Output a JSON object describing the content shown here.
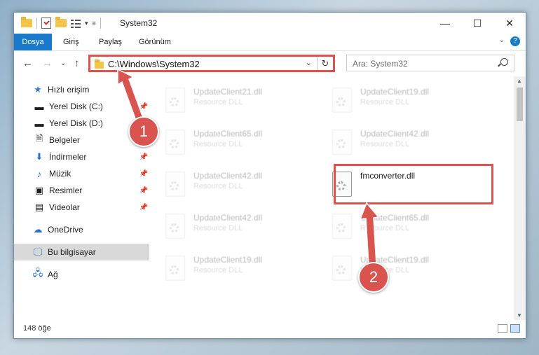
{
  "window": {
    "title": "System32",
    "controls": {
      "minimize": "—",
      "maximize": "☐",
      "close": "✕"
    },
    "quick_access_arrow": "▾"
  },
  "ribbon": {
    "tabs": [
      "Dosya",
      "Giriş",
      "Paylaş",
      "Görünüm"
    ],
    "expand_icon": "⌄",
    "help": "?"
  },
  "address": {
    "path": "C:\\Windows\\System32",
    "dropdown": "⌄",
    "refresh": "↻",
    "search_placeholder": "Ara: System32"
  },
  "nav_buttons": {
    "back": "←",
    "forward": "→",
    "recent": "⌄",
    "up": "↑"
  },
  "nav_pane": {
    "quick_access": "Hızlı erişim",
    "items": [
      {
        "label": "Yerel Disk (C:)",
        "icon": "drive-icon",
        "pinned": true
      },
      {
        "label": "Yerel Disk (D:)",
        "icon": "drive-icon",
        "pinned": false
      },
      {
        "label": "Belgeler",
        "icon": "documents-icon",
        "pinned": false
      },
      {
        "label": "İndirmeler",
        "icon": "download-icon",
        "pinned": true
      },
      {
        "label": "Müzik",
        "icon": "music-icon",
        "pinned": true
      },
      {
        "label": "Resimler",
        "icon": "pictures-icon",
        "pinned": true
      },
      {
        "label": "Videolar",
        "icon": "videos-icon",
        "pinned": true
      }
    ],
    "onedrive": "OneDrive",
    "this_pc": "Bu bilgisayar",
    "network": "Ağ"
  },
  "files": [
    {
      "name": "UpdateClient21.dll",
      "type": "Resource DLL"
    },
    {
      "name": "UpdateClient19.dll",
      "type": "Resource DLL"
    },
    {
      "name": "UpdateClient65.dll",
      "type": "Resource DLL"
    },
    {
      "name": "UpdateClient42.dll",
      "type": "Resource DLL"
    },
    {
      "name": "UpdateClient42.dll",
      "type": "Resource DLL"
    },
    {
      "name": "fmconverter.dll",
      "type": ""
    },
    {
      "name": "UpdateClient42.dll",
      "type": "Resource DLL"
    },
    {
      "name": "UpdateClient65.dll",
      "type": "Resource DLL"
    },
    {
      "name": "UpdateClient19.dll",
      "type": "Resource DLL"
    },
    {
      "name": "UpdateClient19.dll",
      "type": "Resource DLL"
    }
  ],
  "status": {
    "count": "148 öğe"
  },
  "annotations": {
    "step1": "1",
    "step2": "2",
    "color": "#d9534f"
  }
}
